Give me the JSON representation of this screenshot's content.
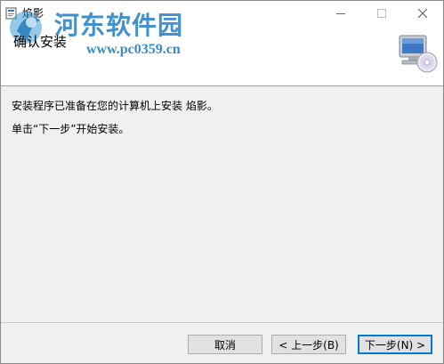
{
  "window": {
    "title": "焰影"
  },
  "watermark": {
    "site_name": "河东软件园",
    "url": "www.pc0359.cn"
  },
  "header": {
    "heading": "确认安装"
  },
  "body": {
    "message1": "安装程序已准备在您的计算机上安装 焰影。",
    "message2": "单击“下一步”开始安装。"
  },
  "buttons": {
    "cancel": "取消",
    "back": "< 上一步(B)",
    "next": "下一步(N) >"
  },
  "colors": {
    "accent": "#0078d7",
    "watermark": "#2c86c8"
  },
  "icons": {
    "app": "app-icon",
    "minimize": "minimize-icon",
    "maximize": "maximize-icon",
    "close": "close-icon",
    "computer": "computer-cd-icon"
  }
}
